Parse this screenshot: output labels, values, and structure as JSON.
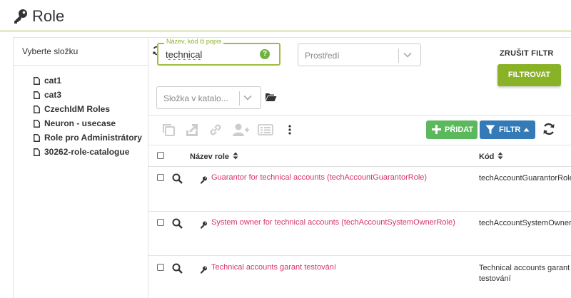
{
  "header": {
    "title": "Role"
  },
  "sidebar": {
    "title": "Vyberte složku",
    "items": [
      {
        "label": "cat1"
      },
      {
        "label": "cat3"
      },
      {
        "label": "CzechIdM Roles"
      },
      {
        "label": "Neuron - usecase"
      },
      {
        "label": "Role pro Administrátory"
      },
      {
        "label": "30262-role-catalogue"
      }
    ]
  },
  "filter": {
    "name_label": "Název, kód či popis",
    "name_value": "technical",
    "help_symbol": "?",
    "environment_placeholder": "Prostředí",
    "catalogue_placeholder": "Složka v katalo...",
    "reset_label": "ZRUŠIT FILTR",
    "apply_label": "FILTROVAT"
  },
  "toolbar": {
    "add_label": "PŘIDAT",
    "filter_label": "FILTR"
  },
  "table": {
    "columns": {
      "name": "Název role",
      "code": "Kód"
    },
    "rows": [
      {
        "name": "Guarantor for technical accounts (techAccountGuarantorRole)",
        "code": "techAccountGuarantorRole"
      },
      {
        "name": "System owner for technical accounts (techAccountSystemOwnerRole)",
        "code": "techAccountSystemOwnerRole"
      },
      {
        "name": "Technical accounts garant testování",
        "code": "Technical accounts garant testování"
      }
    ]
  },
  "colors": {
    "accent_green": "#8ab227",
    "add_green": "#5cb85c",
    "filter_blue": "#337ab7",
    "link_pink": "#d6336c"
  },
  "icons": [
    "key-icon",
    "file-icon",
    "refresh-icon",
    "help-icon",
    "chevron-down-icon",
    "folder-open-icon",
    "copy-icon",
    "export-icon",
    "link-icon",
    "add-user-icon",
    "list-icon",
    "more-vertical-icon",
    "plus-icon",
    "funnel-icon",
    "caret-up-icon",
    "sort-icon",
    "search-icon"
  ]
}
